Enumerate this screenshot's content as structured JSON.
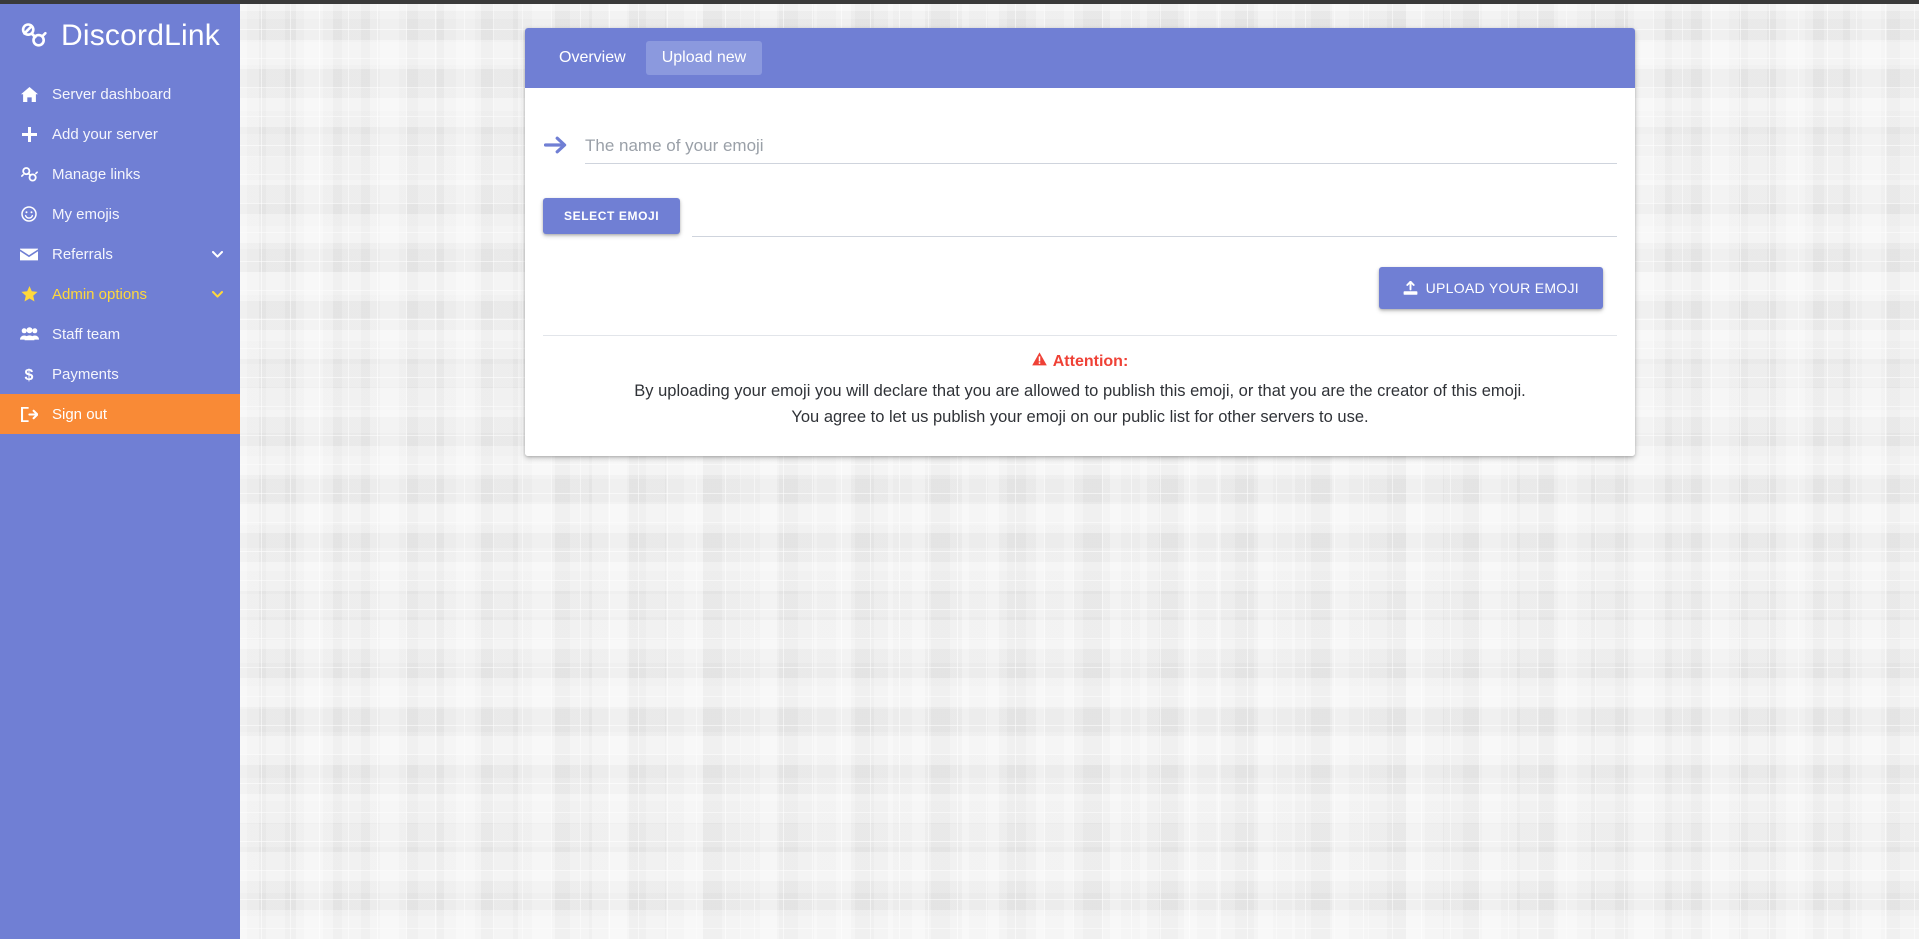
{
  "brand": {
    "name": "DiscordLink",
    "icon": "link-chain-icon"
  },
  "theme": {
    "sidebar_bg": "#707fd4",
    "accent": "#707fd4",
    "accent_light": "#8b99de",
    "signout_bg": "#f98a36",
    "admin_text": "#ffd83b",
    "attention_red": "#ef4136",
    "page_bg": "#ececec"
  },
  "sidebar": {
    "items": [
      {
        "label": "Server dashboard",
        "icon": "home-icon",
        "caret": false,
        "active": false,
        "style": "default"
      },
      {
        "label": "Add your server",
        "icon": "plus-icon",
        "caret": false,
        "active": false,
        "style": "default"
      },
      {
        "label": "Manage links",
        "icon": "link-icon",
        "caret": false,
        "active": false,
        "style": "default"
      },
      {
        "label": "My emojis",
        "icon": "smile-icon",
        "caret": false,
        "active": false,
        "style": "default"
      },
      {
        "label": "Referrals",
        "icon": "envelope-icon",
        "caret": true,
        "active": false,
        "style": "default"
      },
      {
        "label": "Admin options",
        "icon": "star-icon",
        "caret": true,
        "active": false,
        "style": "admin"
      },
      {
        "label": "Staff team",
        "icon": "users-icon",
        "caret": false,
        "active": false,
        "style": "default"
      },
      {
        "label": "Payments",
        "icon": "dollar-icon",
        "caret": false,
        "active": false,
        "style": "default"
      },
      {
        "label": "Sign out",
        "icon": "signout-icon",
        "caret": false,
        "active": true,
        "style": "signout"
      }
    ]
  },
  "card": {
    "tabs": [
      {
        "label": "Overview",
        "active": false
      },
      {
        "label": "Upload new",
        "active": true
      }
    ],
    "name_field": {
      "placeholder": "The name of your emoji",
      "value": "",
      "icon": "arrow-right-icon"
    },
    "select_button": {
      "label": "Select emoji"
    },
    "upload_button": {
      "label": "Upload your emoji",
      "icon": "upload-icon"
    },
    "notice": {
      "icon": "warning-triangle-icon",
      "title": "Attention:",
      "line1": "By uploading your emoji you will declare that you are allowed to publish this emoji, or that you are the creator of this emoji.",
      "line2": "You agree to let us publish your emoji on our public list for other servers to use."
    }
  }
}
